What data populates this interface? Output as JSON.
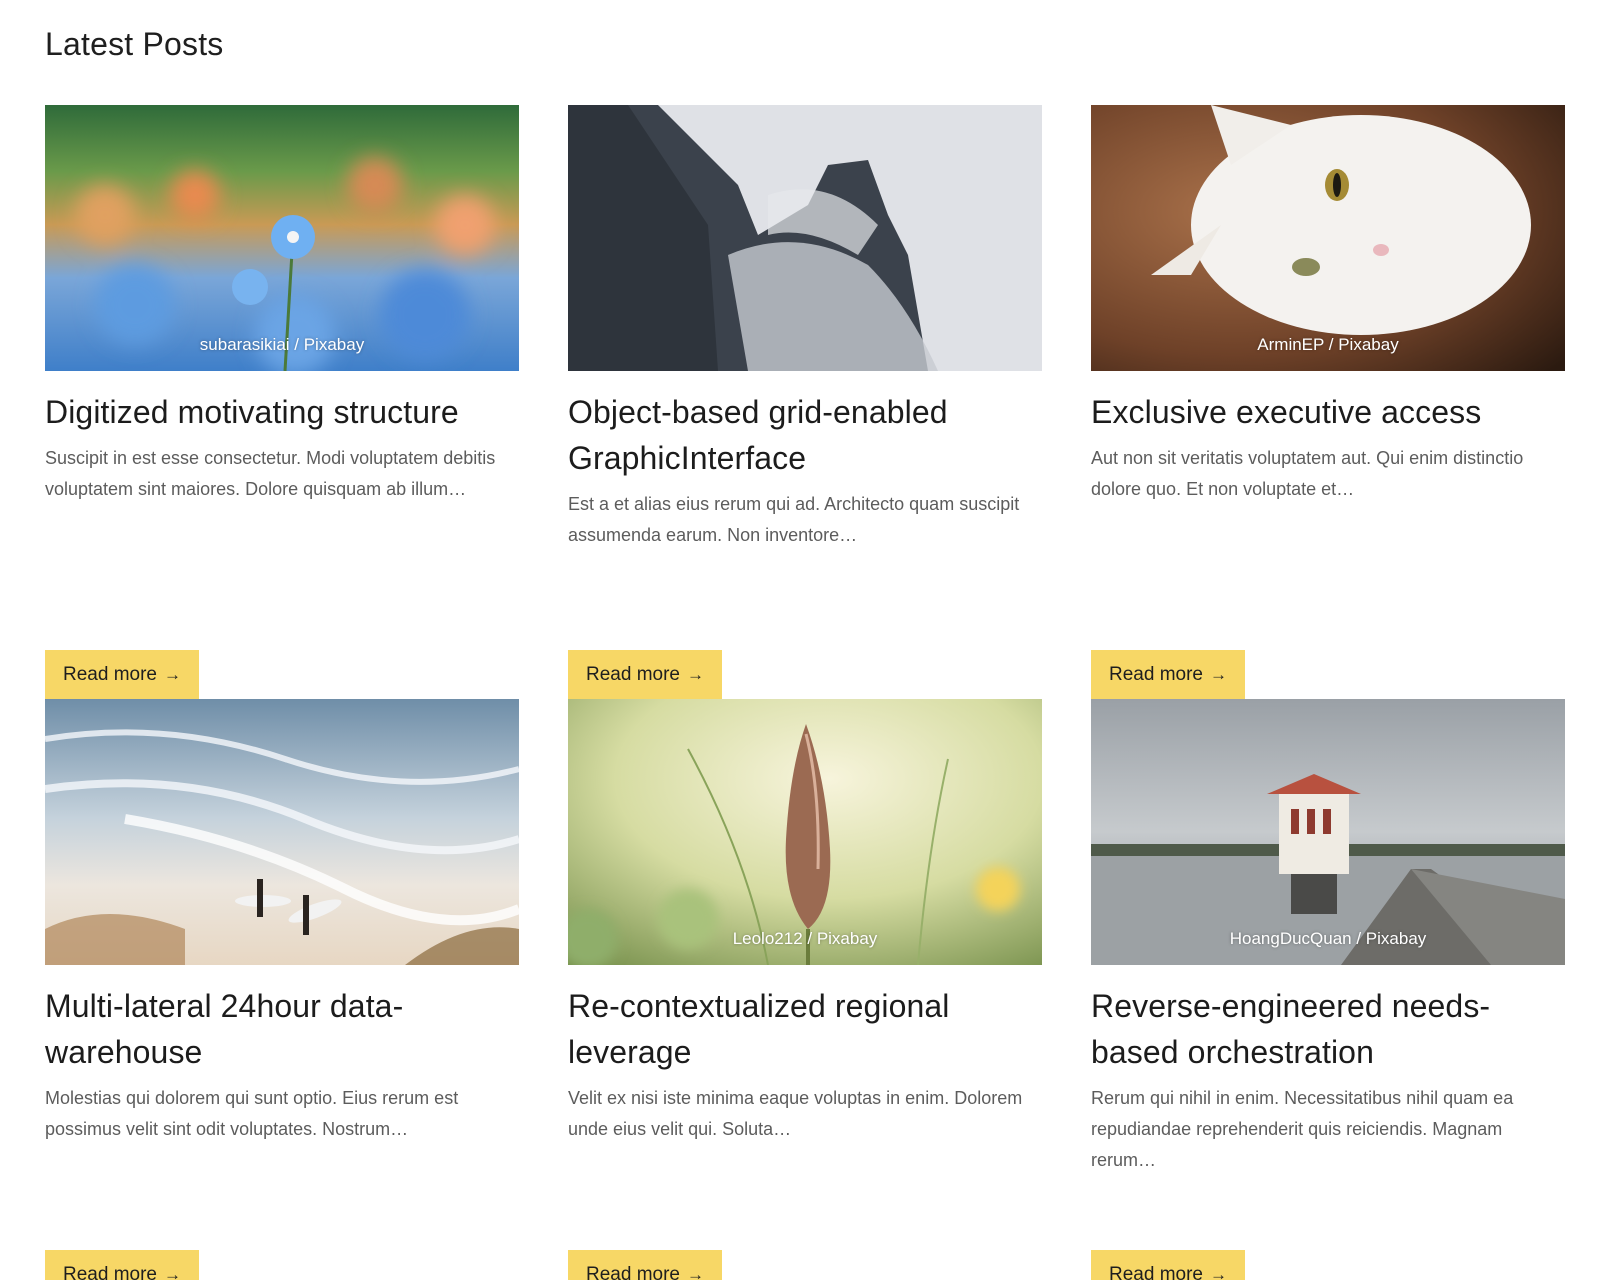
{
  "section": {
    "title": "Latest Posts"
  },
  "posts": [
    {
      "title": "Digitized motivating structure",
      "excerpt": "Suscipit in est esse consectetur. Modi voluptatem debitis voluptatem sint maiores. Dolore quisquam ab illum…",
      "credit": "subarasikiai / Pixabay",
      "image": "blue-flowers-field",
      "button": "Read more"
    },
    {
      "title": "Object-based grid-enabled GraphicInterface",
      "excerpt": "Est a et alias eius rerum qui ad. Architecto quam suscipit assumenda earum. Non inventore…",
      "credit": "",
      "image": "misty-cliffs",
      "button": "Read more"
    },
    {
      "title": "Exclusive executive access",
      "excerpt": "Aut non sit veritatis voluptatem aut. Qui enim distinctio dolore quo. Et non voluptate et…",
      "credit": "ArminEP / Pixabay",
      "image": "white-cat",
      "button": "Read more"
    },
    {
      "title": "Multi-lateral 24hour data-warehouse",
      "excerpt": "Molestias qui dolorem qui sunt optio. Eius rerum est possimus velit sint odit voluptates. Nostrum…",
      "credit": "",
      "image": "beach-surfers",
      "button": "Read more"
    },
    {
      "title": "Re-contextualized regional leverage",
      "excerpt": "Velit ex nisi iste minima eaque voluptas in enim. Dolorem unde eius velit qui. Soluta…",
      "credit": "Leolo212 / Pixabay",
      "image": "wild-flower-spike",
      "button": "Read more"
    },
    {
      "title": "Reverse-engineered needs-based orchestration",
      "excerpt": "Rerum qui nihil in enim. Necessitatibus nihil quam ea repudiandae reprehenderit quis reiciendis. Magnam rerum…",
      "credit": "HoangDucQuan / Pixabay",
      "image": "lake-tower-bridge",
      "button": "Read more"
    }
  ],
  "colors": {
    "button_bg": "#f7d766",
    "title_text": "#1c1c1c",
    "excerpt_text": "#5c5c5c"
  },
  "icons": {
    "read_more": "arrow-right-icon"
  }
}
